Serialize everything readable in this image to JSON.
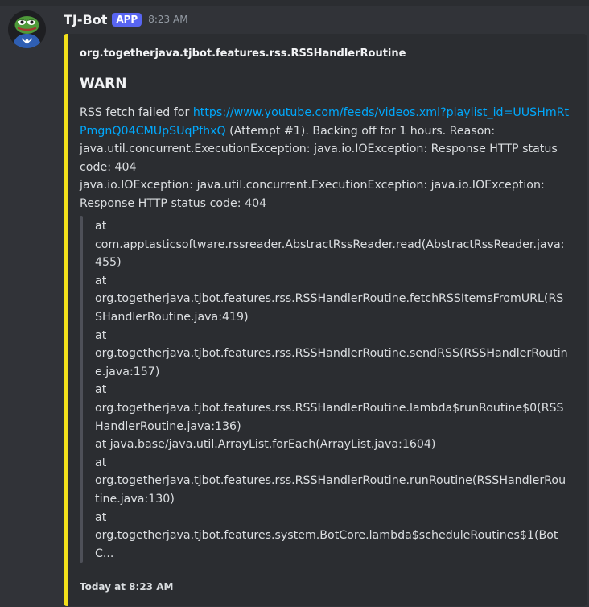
{
  "message": {
    "username": "TJ-Bot",
    "badge": "APP",
    "timestamp": "8:23 AM",
    "avatar_icon": "pepe-frog-avatar-icon"
  },
  "embed": {
    "accent_color": "#f2e01b",
    "author": "org.togetherjava.tjbot.features.rss.RSSHandlerRoutine",
    "title": "WARN",
    "desc_prefix": "RSS fetch failed for ",
    "link": "https://www.youtube.com/feeds/videos.xml?playlist_id=UUSHmRtPmgnQ04CMUpSUqPfhxQ",
    "desc_suffix": " (Attempt #1). Backing off for 1 hours. Reason: java.util.concurrent.ExecutionException: java.io.IOException: Response HTTP status code: 404",
    "desc_line2": "java.io.IOException: java.util.concurrent.ExecutionException: java.io.IOException: Response HTTP status code: 404",
    "stacktrace": [
      "at",
      "com.apptasticsoftware.rssreader.AbstractRssReader.read(AbstractRssReader.java:455)",
      "at",
      "org.togetherjava.tjbot.features.rss.RSSHandlerRoutine.fetchRSSItemsFromURL(RSSHandlerRoutine.java:419)",
      "at",
      "org.togetherjava.tjbot.features.rss.RSSHandlerRoutine.sendRSS(RSSHandlerRoutine.java:157)",
      "at",
      "org.togetherjava.tjbot.features.rss.RSSHandlerRoutine.lambda$runRoutine$0(RSSHandlerRoutine.java:136)",
      "at java.base/java.util.ArrayList.forEach(ArrayList.java:1604)",
      "at",
      "org.togetherjava.tjbot.features.rss.RSSHandlerRoutine.runRoutine(RSSHandlerRoutine.java:130)",
      "at",
      "org.togetherjava.tjbot.features.system.BotCore.lambda$scheduleRoutines$1(BotC..."
    ],
    "footer": "Today at 8:23 AM"
  }
}
